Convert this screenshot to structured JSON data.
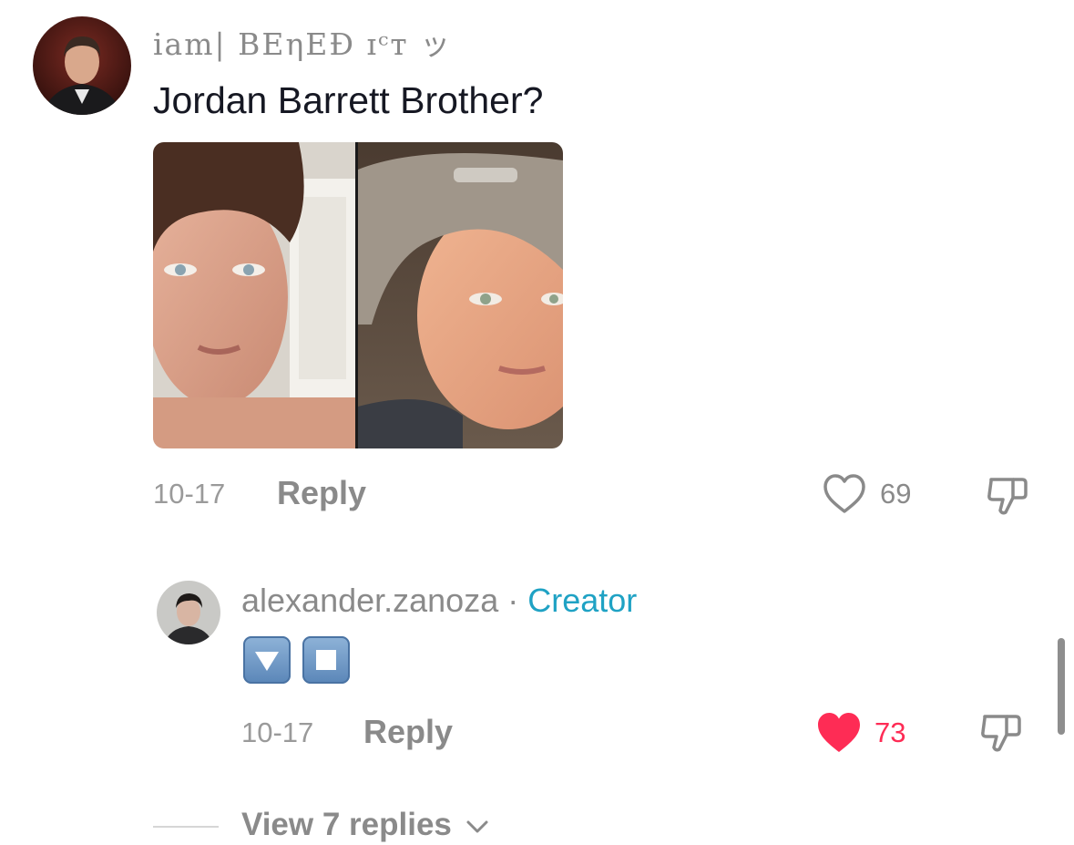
{
  "comment": {
    "username": "iam| BEηEÐ ɪᶜᴛ ッ",
    "text": "Jordan Barrett Brother?",
    "date": "10-17",
    "reply_label": "Reply",
    "like_count": "69",
    "liked": false
  },
  "reply": {
    "username": "alexander.zanoza",
    "separator": "·",
    "badge": "Creator",
    "emojis": [
      "down-button-emoji",
      "stop-button-emoji"
    ],
    "date": "10-17",
    "reply_label": "Reply",
    "like_count": "73",
    "liked": true
  },
  "view_replies_label": "View 7 replies",
  "colors": {
    "liked_red": "#fe2c55",
    "creator_blue": "#1fa2c4",
    "muted_gray": "#8a8a8a"
  }
}
